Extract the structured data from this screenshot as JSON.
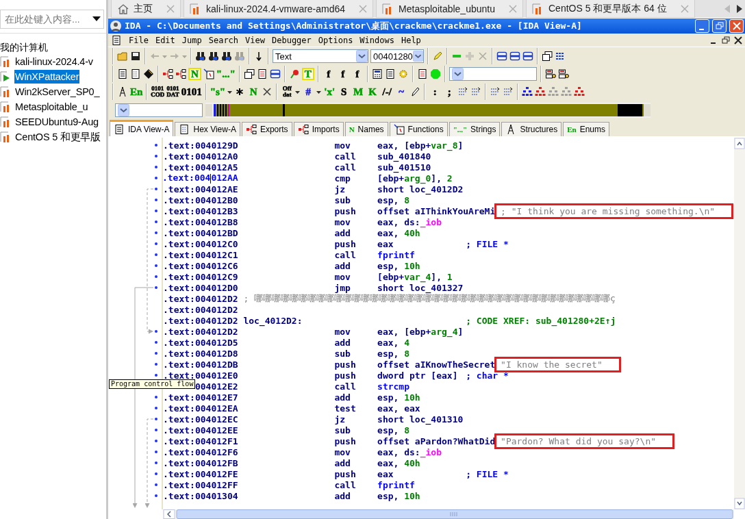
{
  "sidebar": {
    "search": {
      "placeholder": "在此处键入内容..."
    },
    "root": {
      "label": "我的计算机",
      "children": [
        {
          "label": "kali-linux-2024.4-v",
          "running": false,
          "selected": false
        },
        {
          "label": "WinXPattacker",
          "running": true,
          "selected": true
        },
        {
          "label": "Win2kServer_SP0_",
          "running": false,
          "selected": false
        },
        {
          "label": "Metasploitable_u",
          "running": false,
          "selected": false
        },
        {
          "label": "SEEDUbuntu9-Aug",
          "running": false,
          "selected": false
        },
        {
          "label": "CentOS 5 和更早版",
          "running": false,
          "selected": false
        }
      ]
    }
  },
  "browser_tabs": [
    {
      "kind": "home",
      "label": "主页"
    },
    {
      "kind": "vm",
      "label": "kali-linux-2024.4-vmware-amd64"
    },
    {
      "kind": "vm",
      "label": "Metasploitable_ubuntu"
    },
    {
      "kind": "vm",
      "label": "CentOS 5 和更早版本 64 位"
    }
  ],
  "ida": {
    "title": "IDA - C:\\Documents and Settings\\Administrator\\桌面\\crackme\\crackme1.exe - [IDA View-A]",
    "menu": [
      "File",
      "Edit",
      "Jump",
      "Search",
      "View",
      "Debugger",
      "Options",
      "Windows",
      "Help"
    ],
    "toolbars": [
      [
        [
          {
            "kind": "folder",
            "disabled": false
          },
          {
            "kind": "disk",
            "disabled": false
          }
        ],
        [
          {
            "kind": "back",
            "disabled": true
          },
          {
            "kind": "caret",
            "disabled": true
          },
          {
            "kind": "forward",
            "disabled": true
          },
          {
            "kind": "caret",
            "disabled": true
          }
        ],
        [
          {
            "kind": "binoculars",
            "disabled": false
          },
          {
            "kind": "binoculars",
            "disabled": false
          },
          {
            "kind": "binoculars",
            "disabled": false
          },
          {
            "kind": "binoculars",
            "disabled": true
          }
        ],
        [
          {
            "kind": "jump",
            "disabled": false
          }
        ],
        [
          {
            "kind": "combo",
            "value": "Text",
            "disabled": false
          },
          {
            "kind": "address",
            "value": "00401280",
            "disabled": false
          }
        ],
        [
          {
            "kind": "highlighter",
            "disabled": false
          }
        ],
        [
          {
            "kind": "minus",
            "disabled": false
          },
          {
            "kind": "plus",
            "disabled": true
          },
          {
            "kind": "cross",
            "disabled": true
          }
        ],
        [
          {
            "kind": "windows",
            "disabled": false
          },
          {
            "kind": "windows",
            "disabled": false
          },
          {
            "kind": "windows",
            "disabled": false
          }
        ],
        [
          {
            "kind": "stack",
            "disabled": false
          },
          {
            "kind": "list",
            "disabled": false
          }
        ]
      ],
      [
        [
          {
            "kind": "doc",
            "disabled": false
          },
          {
            "kind": "hex",
            "disabled": false
          },
          {
            "kind": "chip",
            "disabled": false
          }
        ],
        [
          {
            "kind": "tree",
            "disabled": false
          },
          {
            "kind": "tree",
            "disabled": false
          },
          {
            "kind": "badge",
            "label": "N",
            "color": "#00a000",
            "disabled": false
          },
          {
            "kind": "fn",
            "disabled": false
          },
          {
            "kind": "glyph",
            "label": "\"...\"",
            "color": "#00a000",
            "disabled": false
          }
        ],
        [
          {
            "kind": "stack",
            "disabled": false
          },
          {
            "kind": "redoc",
            "disabled": false
          },
          {
            "kind": "windows",
            "disabled": false
          }
        ],
        [
          {
            "kind": "flower",
            "disabled": false
          },
          {
            "kind": "badge",
            "label": "T",
            "color": "#00a000",
            "disabled": false
          }
        ],
        [
          {
            "kind": "glyph",
            "label": "f",
            "color": "#000000",
            "disabled": false
          },
          {
            "kind": "glyph",
            "label": "f",
            "color": "#000000",
            "disabled": false
          },
          {
            "kind": "glyph",
            "label": "f",
            "color": "#000000",
            "disabled": false
          }
        ],
        [
          {
            "kind": "calc",
            "disabled": false
          },
          {
            "kind": "doc",
            "disabled": false
          },
          {
            "kind": "gear",
            "disabled": false
          }
        ],
        [
          {
            "kind": "redoc",
            "disabled": false
          },
          {
            "kind": "octagon",
            "disabled": false
          }
        ],
        [
          {
            "kind": "combo",
            "disabled": false
          }
        ],
        [
          {
            "kind": "db",
            "disabled": false
          },
          {
            "kind": "db",
            "disabled": false
          }
        ]
      ],
      [
        [
          {
            "kind": "antenna",
            "disabled": false
          },
          {
            "kind": "glyph",
            "label": "En",
            "color": "#00a000",
            "disabled": false
          }
        ],
        [
          {
            "kind": "glyph",
            "label": "0101\nCOD",
            "color": "#000000",
            "disabled": false
          },
          {
            "kind": "glyph",
            "label": "0101\nDAT",
            "color": "#000000",
            "disabled": false
          },
          {
            "kind": "glyph",
            "label": "0101",
            "color": "#000000",
            "disabled": false
          }
        ],
        [
          {
            "kind": "glyph",
            "label": "\"s\"",
            "color": "#00a000",
            "disabled": false
          },
          {
            "kind": "caret",
            "disabled": false
          },
          {
            "kind": "asterisk",
            "disabled": false
          },
          {
            "kind": "glyph",
            "label": "N",
            "color": "#00a000",
            "disabled": false
          },
          {
            "kind": "cross",
            "disabled": false
          }
        ],
        [
          {
            "kind": "glyph",
            "label": "Off\ndat",
            "color": "#000000",
            "disabled": false
          },
          {
            "kind": "caret",
            "disabled": false
          },
          {
            "kind": "glyph",
            "label": "#",
            "color": "#2020e0",
            "disabled": false
          },
          {
            "kind": "caret",
            "disabled": false
          },
          {
            "kind": "glyph",
            "label": "'x'",
            "color": "#00a000",
            "disabled": false
          },
          {
            "kind": "glyph",
            "label": "S",
            "color": "#000000",
            "disabled": false
          },
          {
            "kind": "glyph",
            "label": "M",
            "color": "#00a000",
            "disabled": false
          },
          {
            "kind": "glyph",
            "label": "K",
            "color": "#00a000",
            "disabled": false
          },
          {
            "kind": "glyph",
            "label": "/-/",
            "color": "#000000",
            "disabled": false
          },
          {
            "kind": "glyph",
            "label": "~",
            "color": "#2020e0",
            "disabled": false
          },
          {
            "kind": "pencil",
            "disabled": false
          }
        ],
        [
          {
            "kind": "glyph",
            "label": ":",
            "color": "#000000",
            "disabled": false
          },
          {
            "kind": "glyph",
            "label": ";",
            "color": "#000000",
            "disabled": false
          },
          {
            "kind": "arrows",
            "disabled": false
          },
          {
            "kind": "arrows",
            "disabled": false
          }
        ],
        [
          {
            "kind": "arrows",
            "disabled": false
          },
          {
            "kind": "arrows",
            "disabled": false
          }
        ],
        [
          {
            "kind": "graph",
            "color": "#2020e0",
            "disabled": false
          },
          {
            "kind": "graph",
            "color": "#e02020",
            "disabled": false
          },
          {
            "kind": "graph",
            "color": "#a0a0a0",
            "disabled": false
          },
          {
            "kind": "graph",
            "color": "#a0a0a0",
            "disabled": false
          },
          {
            "kind": "graph",
            "color": "#e02020",
            "disabled": false
          }
        ]
      ]
    ],
    "views": [
      {
        "label": "IDA View-A",
        "kind": "doc",
        "selected": true
      },
      {
        "label": "Hex View-A",
        "kind": "hex",
        "selected": false
      },
      {
        "label": "Exports",
        "kind": "tree",
        "selected": false
      },
      {
        "label": "Imports",
        "kind": "tree",
        "selected": false
      },
      {
        "label": "Names",
        "kind": "glyph",
        "glyph": "N",
        "selected": false
      },
      {
        "label": "Functions",
        "kind": "fn",
        "selected": false
      },
      {
        "label": "Strings",
        "kind": "glyph",
        "glyph": "\"...\"",
        "selected": false
      },
      {
        "label": "Structures",
        "kind": "antenna",
        "selected": false
      },
      {
        "label": "Enums",
        "kind": "glyph",
        "glyph": "En",
        "selected": false
      }
    ],
    "listing": [
      {
        "kind": "insn",
        "current": false,
        "address": ".text:0040129D",
        "mnemonic": "mov",
        "operands": [
          {
            "text": "eax, [ebp+",
            "kind": "plain"
          },
          {
            "text": "var_8",
            "kind": "name"
          },
          {
            "text": "]",
            "kind": "plain"
          }
        ]
      },
      {
        "kind": "insn",
        "current": false,
        "address": ".text:004012A0",
        "mnemonic": "call",
        "operands": [
          {
            "text": "sub_401840",
            "kind": "plain"
          }
        ]
      },
      {
        "kind": "insn",
        "current": false,
        "address": ".text:004012A5",
        "mnemonic": "call",
        "operands": [
          {
            "text": "sub_401510",
            "kind": "plain"
          }
        ]
      },
      {
        "kind": "insn",
        "current": true,
        "address": ".text:004012AA",
        "mnemonic": "cmp",
        "operands": [
          {
            "text": "[ebp+",
            "kind": "plain"
          },
          {
            "text": "arg_0",
            "kind": "name"
          },
          {
            "text": "], ",
            "kind": "plain"
          },
          {
            "text": "2",
            "kind": "num"
          }
        ]
      },
      {
        "kind": "insn",
        "current": false,
        "address": ".text:004012AE",
        "mnemonic": "jz",
        "operands": [
          {
            "text": "short loc_4012D2",
            "kind": "plain"
          }
        ]
      },
      {
        "kind": "insn",
        "current": false,
        "address": ".text:004012B0",
        "mnemonic": "sub",
        "operands": [
          {
            "text": "esp, ",
            "kind": "plain"
          },
          {
            "text": "8",
            "kind": "num"
          }
        ]
      },
      {
        "kind": "insn",
        "current": false,
        "address": ".text:004012B3",
        "mnemonic": "push",
        "operands": [
          {
            "text": "offset aIThinkYouAreMi",
            "kind": "plain"
          }
        ],
        "comment": {
          "text": "; \"I think you are missing something.\\n\"",
          "kind": "string",
          "boxed": true
        }
      },
      {
        "kind": "insn",
        "current": false,
        "address": ".text:004012B8",
        "mnemonic": "mov",
        "operands": [
          {
            "text": "eax, ds:",
            "kind": "plain"
          },
          {
            "text": "_iob",
            "kind": "import"
          }
        ]
      },
      {
        "kind": "insn",
        "current": false,
        "address": ".text:004012BD",
        "mnemonic": "add",
        "operands": [
          {
            "text": "eax, ",
            "kind": "plain"
          },
          {
            "text": "40h",
            "kind": "num"
          }
        ]
      },
      {
        "kind": "insn",
        "current": false,
        "address": ".text:004012C0",
        "mnemonic": "push",
        "operands": [
          {
            "text": "eax",
            "kind": "plain"
          }
        ],
        "comment": {
          "text": "; FILE *",
          "kind": "type",
          "boxed": false
        }
      },
      {
        "kind": "insn",
        "current": false,
        "address": ".text:004012C1",
        "mnemonic": "call",
        "operands": [
          {
            "text": "fprintf",
            "kind": "call"
          }
        ]
      },
      {
        "kind": "insn",
        "current": false,
        "address": ".text:004012C6",
        "mnemonic": "add",
        "operands": [
          {
            "text": "esp, ",
            "kind": "plain"
          },
          {
            "text": "10h",
            "kind": "num"
          }
        ]
      },
      {
        "kind": "insn",
        "current": false,
        "address": ".text:004012C9",
        "mnemonic": "mov",
        "operands": [
          {
            "text": "[ebp+",
            "kind": "plain"
          },
          {
            "text": "var_4",
            "kind": "name"
          },
          {
            "text": "], ",
            "kind": "plain"
          },
          {
            "text": "1",
            "kind": "num"
          }
        ]
      },
      {
        "kind": "insn",
        "current": false,
        "address": ".text:004012D0",
        "mnemonic": "jmp",
        "operands": [
          {
            "text": "short loc_401327",
            "kind": "plain"
          }
        ]
      },
      {
        "kind": "junk",
        "current": false,
        "address": ".text:004012D2",
        "comment": {
          "text": "; 哪哪哪哪哪哪哪哪哪哪哪哪哪哪哪哪哪哪哪哪哪哪哪哪哪哪哪哪哪哪哪哪哪哪哪哪哪哪哪哪ç",
          "kind": "junk",
          "boxed": false
        }
      },
      {
        "kind": "blank",
        "current": false,
        "address": ".text:004012D2"
      },
      {
        "kind": "label",
        "current": false,
        "address": ".text:004012D2",
        "label": "loc_4012D2:",
        "comment": {
          "text": "; CODE XREF: sub_401280+2E↑j",
          "kind": "xref",
          "boxed": false
        }
      },
      {
        "kind": "insn",
        "current": false,
        "address": ".text:004012D2",
        "mnemonic": "mov",
        "operands": [
          {
            "text": "eax, [ebp+",
            "kind": "plain"
          },
          {
            "text": "arg_4",
            "kind": "name"
          },
          {
            "text": "]",
            "kind": "plain"
          }
        ]
      },
      {
        "kind": "insn",
        "current": false,
        "address": ".text:004012D5",
        "mnemonic": "add",
        "operands": [
          {
            "text": "eax, ",
            "kind": "plain"
          },
          {
            "text": "4",
            "kind": "num"
          }
        ]
      },
      {
        "kind": "insn",
        "current": false,
        "address": ".text:004012D8",
        "mnemonic": "sub",
        "operands": [
          {
            "text": "esp, ",
            "kind": "plain"
          },
          {
            "text": "8",
            "kind": "num"
          }
        ]
      },
      {
        "kind": "insn",
        "current": false,
        "address": ".text:004012DB",
        "mnemonic": "push",
        "operands": [
          {
            "text": "offset aIKnowTheSecret",
            "kind": "plain"
          }
        ],
        "comment": {
          "text": "\"I know the secret\"",
          "kind": "string",
          "boxed": true
        }
      },
      {
        "kind": "insn",
        "current": false,
        "address": ".text:004012E0",
        "mnemonic": "push",
        "operands": [
          {
            "text": "dword ptr [eax]",
            "kind": "plain"
          }
        ],
        "comment": {
          "text": "; char *",
          "kind": "type",
          "boxed": false
        }
      },
      {
        "kind": "insn",
        "current": false,
        "address": "004012E2",
        "mnemonic": "call",
        "operands": [
          {
            "text": "strcmp",
            "kind": "call"
          }
        ]
      },
      {
        "kind": "insn",
        "current": false,
        "address": ".text:004012E7",
        "mnemonic": "add",
        "operands": [
          {
            "text": "esp, ",
            "kind": "plain"
          },
          {
            "text": "10h",
            "kind": "num"
          }
        ]
      },
      {
        "kind": "insn",
        "current": false,
        "address": ".text:004012EA",
        "mnemonic": "test",
        "operands": [
          {
            "text": "eax, eax",
            "kind": "plain"
          }
        ]
      },
      {
        "kind": "insn",
        "current": false,
        "address": ".text:004012EC",
        "mnemonic": "jz",
        "operands": [
          {
            "text": "short loc_401310",
            "kind": "plain"
          }
        ]
      },
      {
        "kind": "insn",
        "current": false,
        "address": ".text:004012EE",
        "mnemonic": "sub",
        "operands": [
          {
            "text": "esp, ",
            "kind": "plain"
          },
          {
            "text": "8",
            "kind": "num"
          }
        ]
      },
      {
        "kind": "insn",
        "current": false,
        "address": ".text:004012F1",
        "mnemonic": "push",
        "operands": [
          {
            "text": "offset aPardon?WhatDid",
            "kind": "plain"
          }
        ],
        "comment": {
          "text": "\"Pardon? What did you say?\\n\"",
          "kind": "string",
          "boxed": true
        }
      },
      {
        "kind": "insn",
        "current": false,
        "address": ".text:004012F6",
        "mnemonic": "mov",
        "operands": [
          {
            "text": "eax, ds:",
            "kind": "plain"
          },
          {
            "text": "_iob",
            "kind": "import"
          }
        ]
      },
      {
        "kind": "insn",
        "current": false,
        "address": ".text:004012FB",
        "mnemonic": "add",
        "operands": [
          {
            "text": "eax, ",
            "kind": "plain"
          },
          {
            "text": "40h",
            "kind": "num"
          }
        ]
      },
      {
        "kind": "insn",
        "current": false,
        "address": ".text:004012FE",
        "mnemonic": "push",
        "operands": [
          {
            "text": "eax",
            "kind": "plain"
          }
        ],
        "comment": {
          "text": "; FILE *",
          "kind": "type",
          "boxed": false
        }
      },
      {
        "kind": "insn",
        "current": false,
        "address": ".text:004012FF",
        "mnemonic": "call",
        "operands": [
          {
            "text": "fprintf",
            "kind": "call"
          }
        ]
      },
      {
        "kind": "insn",
        "current": false,
        "address": ".text:00401304",
        "mnemonic": "add",
        "operands": [
          {
            "text": "esp, ",
            "kind": "plain"
          },
          {
            "text": "10h",
            "kind": "num"
          }
        ]
      }
    ],
    "tooltip": "Program control flow"
  }
}
